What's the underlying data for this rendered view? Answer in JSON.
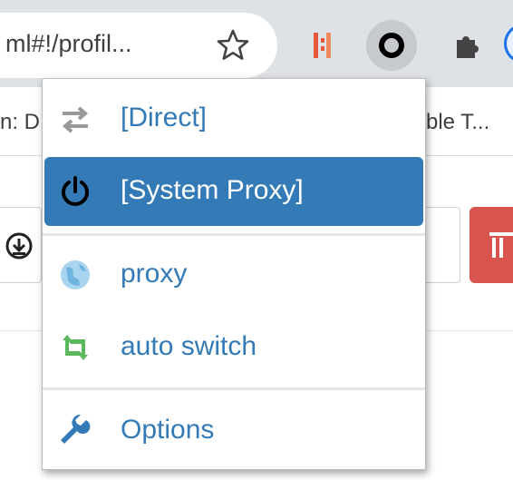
{
  "browser": {
    "address_bar": {
      "url_text": "ml#!/profil..."
    },
    "icons": {
      "bookmark_star": "star-icon",
      "extension_1": "bookmark-extension-icon",
      "extension_active": "switchyomega-icon",
      "extensions_menu": "puzzle-icon"
    }
  },
  "bookmarks_bar": {
    "items": [
      {
        "label": "n: D"
      },
      {
        "label": "ble T..."
      }
    ]
  },
  "popup": {
    "items": [
      {
        "label": "[Direct]",
        "icon": "swap-arrows-icon",
        "icon_color": "#999999"
      },
      {
        "label": "[System Proxy]",
        "icon": "power-icon",
        "selected": true,
        "icon_color": "#000000"
      },
      {
        "label": "proxy",
        "icon": "globe-icon",
        "icon_color": "#99ccee"
      },
      {
        "label": "auto switch",
        "icon": "retweet-icon",
        "icon_color": "#55bb55"
      },
      {
        "label": "Options",
        "icon": "wrench-icon",
        "icon_color": "#337ab7"
      }
    ],
    "colors": {
      "accent": "#337ab7",
      "selected_text": "#ffffff"
    }
  },
  "page": {
    "colors": {
      "delete_button": "#d9534f"
    }
  }
}
